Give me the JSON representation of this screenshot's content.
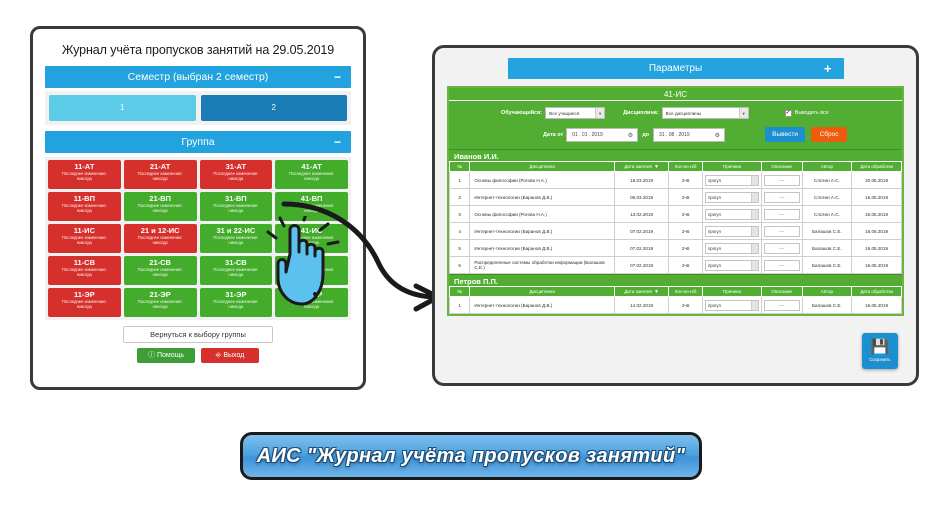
{
  "left_panel": {
    "title": "Журнал учёта пропусков занятий на 29.05.2019",
    "semester_bar": {
      "label": "Семестр (выбран 2 семестр)",
      "sign": "−"
    },
    "semesters": [
      {
        "label": "1",
        "selected": false
      },
      {
        "label": "2",
        "selected": true
      }
    ],
    "group_bar": {
      "label": "Группа",
      "sign": "−"
    },
    "group_sub_line1": "Последнее изменение:",
    "group_sub_line2": "никогда",
    "groups": [
      {
        "name": "11-АТ",
        "state": "red"
      },
      {
        "name": "21-АТ",
        "state": "red"
      },
      {
        "name": "31-АТ",
        "state": "red"
      },
      {
        "name": "41-АТ",
        "state": "green"
      },
      {
        "name": "11-ВП",
        "state": "red"
      },
      {
        "name": "21-ВП",
        "state": "green"
      },
      {
        "name": "31-ВП",
        "state": "green"
      },
      {
        "name": "41-ВП",
        "state": "green"
      },
      {
        "name": "11-ИС",
        "state": "red"
      },
      {
        "name": "21 и 12-ИС",
        "state": "red"
      },
      {
        "name": "31 и 22-ИС",
        "state": "green"
      },
      {
        "name": "41-ИС",
        "state": "green"
      },
      {
        "name": "11-СВ",
        "state": "red"
      },
      {
        "name": "21-СВ",
        "state": "green"
      },
      {
        "name": "31-СВ",
        "state": "green"
      },
      {
        "name": "41-СВ",
        "state": "green"
      },
      {
        "name": "11-ЭР",
        "state": "red"
      },
      {
        "name": "21-ЭР",
        "state": "green"
      },
      {
        "name": "31-ЭР",
        "state": "green"
      },
      {
        "name": "41-ЭР",
        "state": "green"
      }
    ],
    "back_button": "Вернуться к выбору группы",
    "help_button": "Помощь",
    "help_icon": "info-circle-icon",
    "exit_button": "Выход",
    "exit_icon": "logout-icon"
  },
  "right_panel": {
    "params_bar": {
      "label": "Параметры",
      "sign": "+"
    },
    "group_title": "41-ИС",
    "filters": {
      "student_label": "Обучающийся:",
      "student_value": "Все учащиеся",
      "discipline_label": "Дисциплина:",
      "discipline_value": "Все дисциплины",
      "show_all_label": "Выводить все",
      "show_all_checked": true,
      "date_from_label": "Дата от",
      "date_from_value": "01 . 01 . 2019",
      "date_to_label": "до",
      "date_to_value": "31 . 08 . 2019",
      "submit_button": "Вывести",
      "reset_button": "Сброс"
    },
    "columns": [
      "№",
      "Дисциплина",
      "Дата занятия",
      "Кол-во н/б",
      "Причина",
      "Описание",
      "Автор",
      "Дата обработки"
    ],
    "sort_column": "Дата занятия",
    "sort_arrow": "▼",
    "description_placeholder": "—",
    "students": [
      {
        "name": "Иванов И.И.",
        "rows": [
          {
            "num": "1",
            "discipline": "Основы философии (Рогова Н.А.)",
            "date": "18.03.2019",
            "count": "2ч6",
            "reason": "прогул",
            "description": "—",
            "author": "Слотин А.С.",
            "processed": "20.05.2019"
          },
          {
            "num": "2",
            "discipline": "Интернет-технологии (Баранов Д.В.)",
            "date": "06.03.2019",
            "count": "2ч6",
            "reason": "прогул",
            "description": "—",
            "author": "Слотин А.С.",
            "processed": "16.05.2019"
          },
          {
            "num": "3",
            "discipline": "Основы философии (Рогова Н.А.)",
            "date": "13.02.2019",
            "count": "2ч6",
            "reason": "прогул",
            "description": "—",
            "author": "Слотин А.С.",
            "processed": "16.05.2019"
          },
          {
            "num": "4",
            "discipline": "Интернет-технологии (Баранов Д.В.)",
            "date": "07.02.2019",
            "count": "2ч6",
            "reason": "прогул",
            "description": "—",
            "author": "Балашов С.Е.",
            "processed": "16.05.2019"
          },
          {
            "num": "5",
            "discipline": "Интернет-технологии (Баранов Д.В.)",
            "date": "07.02.2019",
            "count": "2ч6",
            "reason": "прогул",
            "description": "—",
            "author": "Балашов С.Е.",
            "processed": "16.05.2019"
          },
          {
            "num": "6",
            "discipline": "Распределенные системы обработки информации (Балашов С.Е.)",
            "date": "07.02.2019",
            "count": "2ч6",
            "reason": "прогул",
            "description": "—",
            "author": "Балашов С.Е.",
            "processed": "16.05.2019"
          }
        ]
      },
      {
        "name": "Петров П.П.",
        "rows": [
          {
            "num": "1",
            "discipline": "Интернет-технологии (Баранов Д.В.)",
            "date": "14.02.2019",
            "count": "2ч6",
            "reason": "прогул",
            "description": "—",
            "author": "Балашов С.Е.",
            "processed": "16.05.2019"
          }
        ]
      }
    ],
    "save_button": {
      "label": "Сохранить",
      "icon": "floppy-disk-icon"
    }
  },
  "banner": {
    "text": "АИС \"Журнал учёта пропусков занятий\""
  },
  "colors": {
    "accent_blue": "#22a3e0",
    "green": "#52ae32",
    "red": "#d6302c",
    "orange": "#ef5b0c",
    "semester_selected": "#1a7cb5",
    "semester_unselected": "#5bcbe8"
  },
  "cursor": {
    "icon": "pointing-hand-cursor",
    "state": "clicking"
  },
  "arrow": {
    "icon": "curved-arrow-icon"
  }
}
